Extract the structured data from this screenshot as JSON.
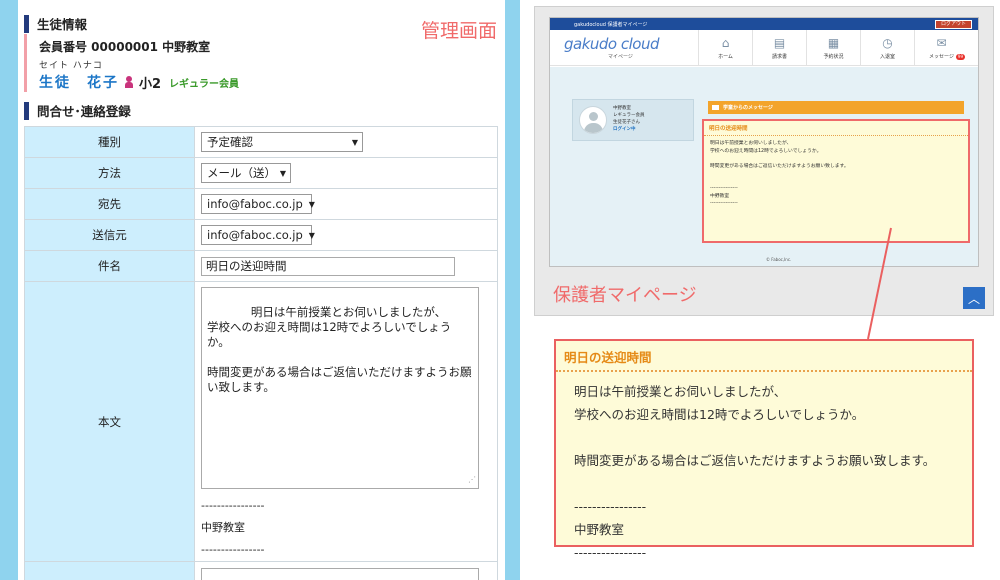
{
  "admin": {
    "caption": "管理画面",
    "student_section": "生徒情報",
    "member_line": "会員番号 00000001 中野教室",
    "kana": "セイト ハナコ",
    "name": "生徒　花子",
    "grade": "小2",
    "member_type": "レギュラー会員",
    "contact_section": "問合せ･連絡登録",
    "form": {
      "type_label": "種別",
      "type_value": "予定確認",
      "method_label": "方法",
      "method_value": "メール（送）",
      "to_label": "宛先",
      "to_value": "info@faboc.co.jp",
      "from_label": "送信元",
      "from_value": "info@faboc.co.jp",
      "subject_label": "件名",
      "subject_value": "明日の送迎時間",
      "body_label": "本文",
      "body_value": "明日は午前授業とお伺いしましたが、\n学校へのお迎え時間は12時でよろしいでしょうか。\n\n時間変更がある場合はご返信いただけますようお願い致します。",
      "sig_line1": "----------------",
      "sig_name": "中野教室",
      "sig_line2": "----------------"
    }
  },
  "mypage": {
    "topbar_brand": "gakudocloud 保護者マイページ",
    "logout_label": "ログアウト",
    "logo_text": "gakudo cloud",
    "logo_sub": "マイページ",
    "nav": [
      {
        "label": "ホーム",
        "icon": "home-icon"
      },
      {
        "label": "請求書",
        "icon": "document-icon"
      },
      {
        "label": "予約状況",
        "icon": "calendar-icon"
      },
      {
        "label": "入退室",
        "icon": "clock-icon"
      },
      {
        "label": "メッセージ",
        "icon": "mail-icon",
        "badge": "99"
      }
    ],
    "profile": {
      "school": "中野教室",
      "member_type": "レギュラー会員",
      "student": "生徒花子さん",
      "status": "ログイン中"
    },
    "message_bar": "学童からのメッセージ",
    "message_title": "明日の送迎時間",
    "message_body": "明日は午前授業とお伺いしましたが、\n学校へのお迎え時間は12時でよろしいでしょうか。\n\n時間変更がある場合はご返信いただけますようお願い致します。\n\n\n----------------\n中野教室\n----------------",
    "footer": "© Faboc,Inc.",
    "caption": "保護者マイページ"
  },
  "zoom": {
    "title": "明日の送迎時間",
    "body": "明日は午前授業とお伺いしましたが、\n学校へのお迎え時間は12時でよろしいでしょうか。\n\n時間変更がある場合はご返信いただけますようお願い致します。\n\n----------------\n中野教室\n----------------"
  },
  "colors": {
    "sky": "#8fd3ee",
    "label_cell": "#cdeefd",
    "accent_red": "#ea6060",
    "orange": "#e58a16",
    "navy": "#233b7d",
    "note_bg": "#fefbd8"
  }
}
